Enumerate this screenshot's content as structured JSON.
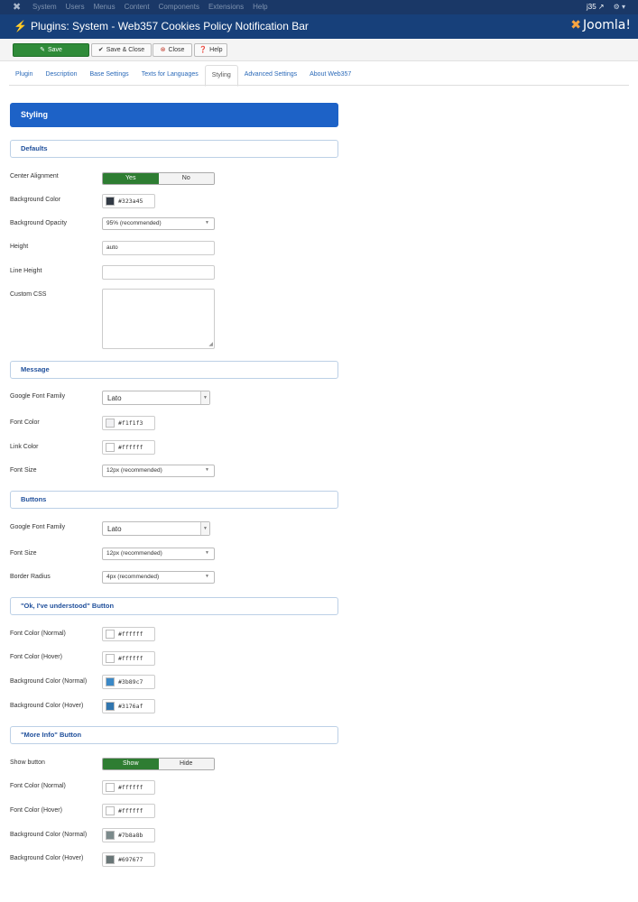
{
  "topbar": {
    "menu": [
      "System",
      "Users",
      "Menus",
      "Content",
      "Components",
      "Extensions",
      "Help"
    ],
    "site_name": "j35 ↗",
    "gear": "⚙ ▾"
  },
  "header": {
    "title": "Plugins: System - Web357 Cookies Policy Notification Bar",
    "logo": "Joomla!"
  },
  "toolbar": {
    "save": "Save",
    "save_close": "Save & Close",
    "close": "Close",
    "help": "Help"
  },
  "tabs": [
    "Plugin",
    "Description",
    "Base Settings",
    "Texts for Languages",
    "Styling",
    "Advanced Settings",
    "About Web357"
  ],
  "active_tab": "Styling",
  "hero_title": "Styling",
  "sections": {
    "defaults": "Defaults",
    "message": "Message",
    "buttons": "Buttons",
    "ok_button": "\"Ok, I've understood\" Button",
    "more_info": "\"More Info\" Button"
  },
  "defaults": {
    "center_alignment": {
      "label": "Center Alignment",
      "yes": "Yes",
      "no": "No",
      "value": "Yes"
    },
    "background_color": {
      "label": "Background Color",
      "value": "#323a45"
    },
    "background_opacity": {
      "label": "Background Opacity",
      "value": "95% (recommended)"
    },
    "height": {
      "label": "Height",
      "value": "auto"
    },
    "line_height": {
      "label": "Line Height",
      "value": ""
    },
    "custom_css": {
      "label": "Custom CSS",
      "value": ""
    }
  },
  "message": {
    "google_font": {
      "label": "Google Font Family",
      "value": "Lato"
    },
    "font_color": {
      "label": "Font Color",
      "value": "#f1f1f3"
    },
    "link_color": {
      "label": "Link Color",
      "value": "#ffffff"
    },
    "font_size": {
      "label": "Font Size",
      "value": "12px (recommended)"
    }
  },
  "buttons": {
    "google_font": {
      "label": "Google Font Family",
      "value": "Lato"
    },
    "font_size": {
      "label": "Font Size",
      "value": "12px (recommended)"
    },
    "border_radius": {
      "label": "Border Radius",
      "value": "4px (recommended)"
    }
  },
  "ok_button": {
    "font_color_normal": {
      "label": "Font Color (Normal)",
      "value": "#ffffff"
    },
    "font_color_hover": {
      "label": "Font Color (Hover)",
      "value": "#ffffff"
    },
    "bg_color_normal": {
      "label": "Background Color (Normal)",
      "value": "#3b89c7"
    },
    "bg_color_hover": {
      "label": "Background Color (Hover)",
      "value": "#3176af"
    }
  },
  "more_info": {
    "show_button": {
      "label": "Show button",
      "show": "Show",
      "hide": "Hide",
      "value": "Show"
    },
    "font_color_normal": {
      "label": "Font Color (Normal)",
      "value": "#ffffff"
    },
    "font_color_hover": {
      "label": "Font Color (Hover)",
      "value": "#ffffff"
    },
    "bg_color_normal": {
      "label": "Background Color (Normal)",
      "value": "#7b8a8b"
    },
    "bg_color_hover": {
      "label": "Background Color (Hover)",
      "value": "#697677"
    }
  }
}
